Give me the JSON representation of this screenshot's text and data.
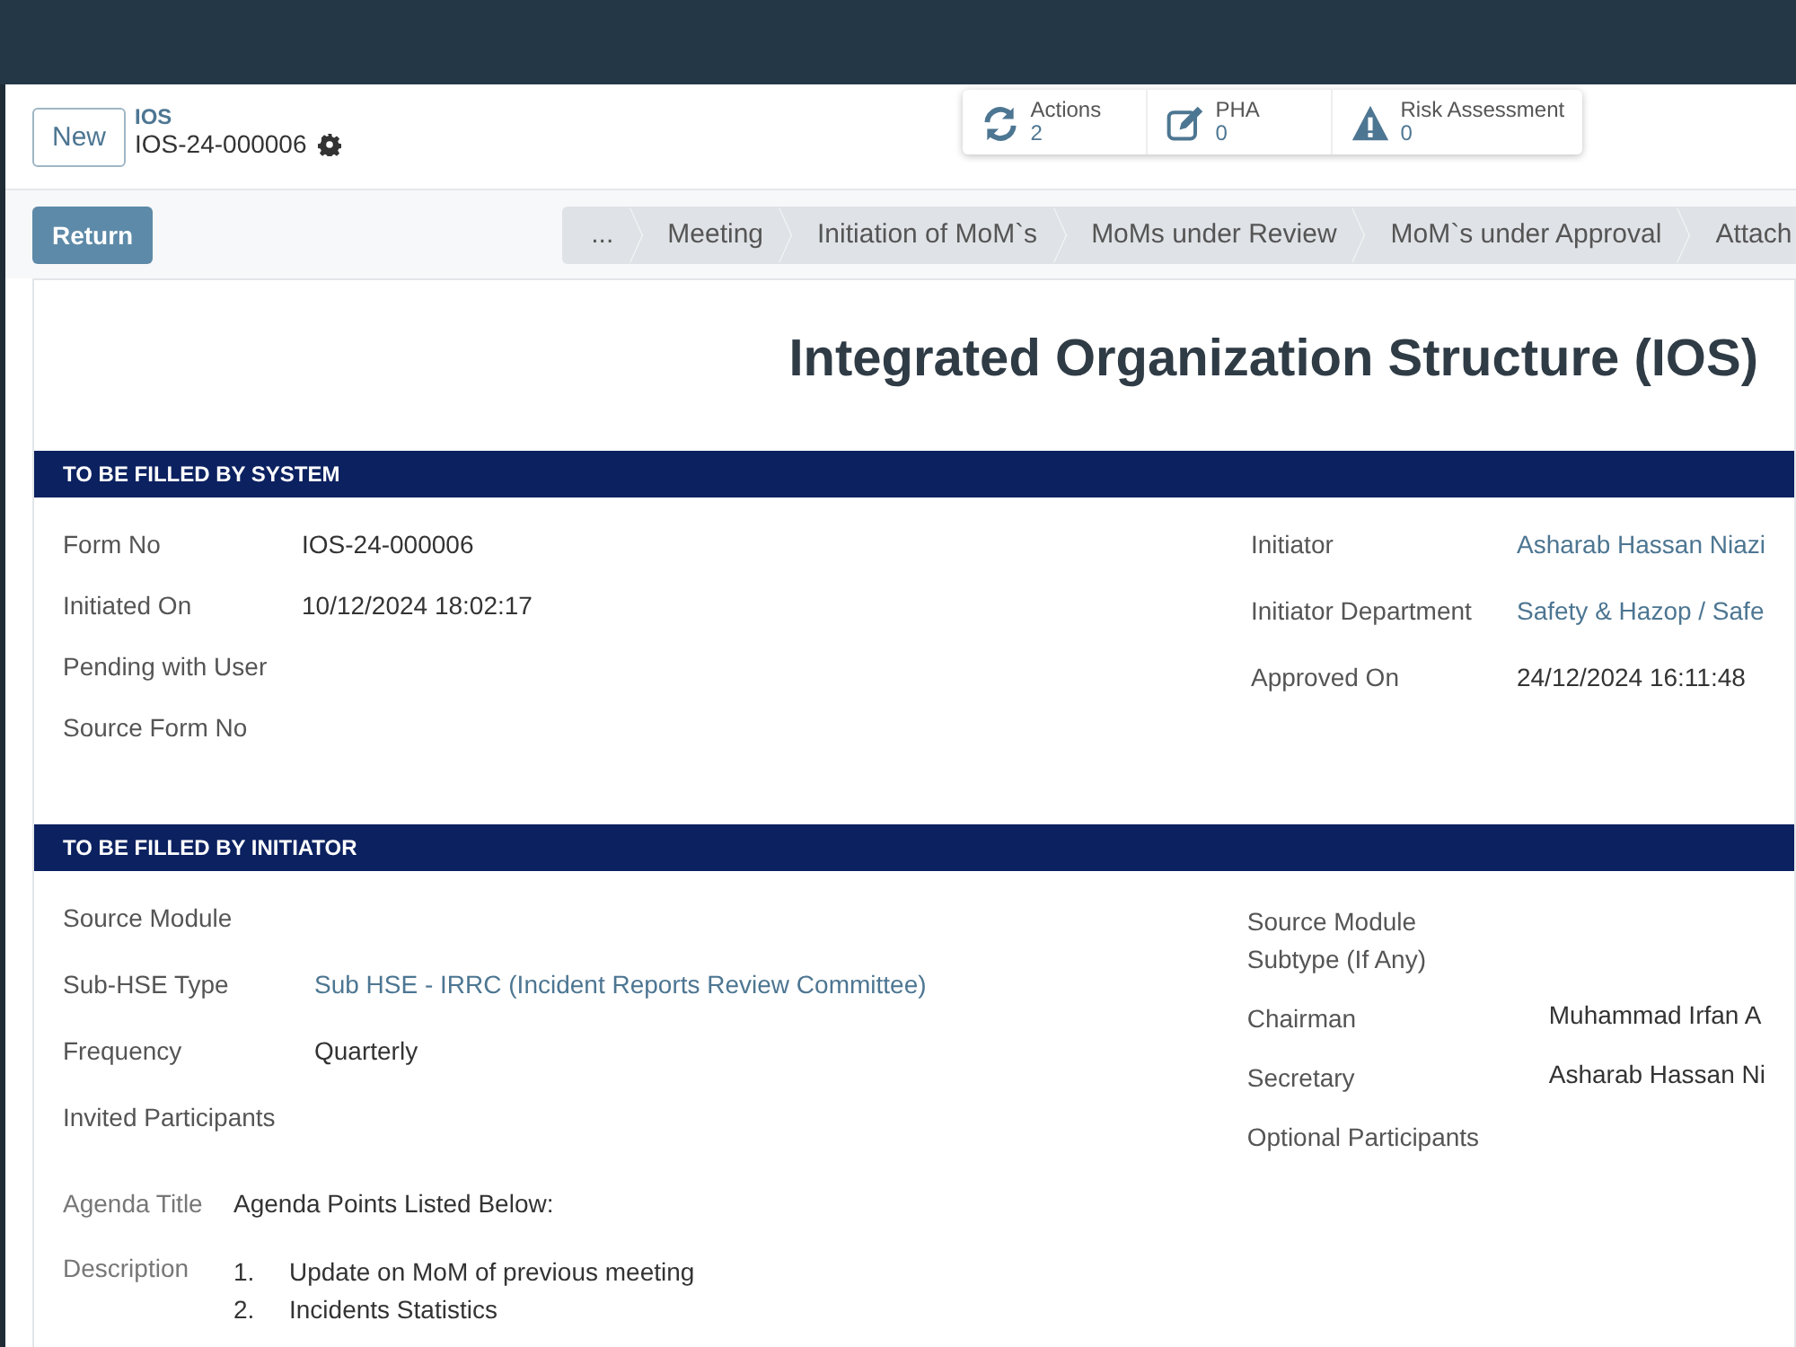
{
  "header": {
    "new_button": "New",
    "module": "IOS",
    "record_no": "IOS-24-000006"
  },
  "stats": [
    {
      "kind": "refresh",
      "label": "Actions",
      "count": "2"
    },
    {
      "kind": "edit",
      "label": "PHA",
      "count": "0"
    },
    {
      "kind": "warning",
      "label": "Risk Assessment",
      "count": "0"
    }
  ],
  "toolbar": {
    "return_button": "Return",
    "steps": [
      "...",
      "Meeting",
      "Initiation of MoM`s",
      "MoMs under Review",
      "MoM`s under Approval",
      "Attach"
    ]
  },
  "form": {
    "title": "Integrated Organization Structure (IOS)",
    "sections": [
      {
        "title": "TO BE FILLED BY SYSTEM",
        "left": [
          {
            "label": "Form No",
            "value": "IOS-24-000006",
            "link": false
          },
          {
            "label": "Initiated On",
            "value": "10/12/2024 18:02:17",
            "link": false
          },
          {
            "label": "Pending with User"
          },
          {
            "label": "Source Form No"
          }
        ],
        "right": [
          {
            "label": "Initiator",
            "value": "Asharab Hassan Niazi",
            "link": true
          },
          {
            "label": "Initiator Department",
            "value": "Safety & Hazop / Safe",
            "link": true
          },
          {
            "label": "Approved On",
            "value": "24/12/2024 16:11:48",
            "link": false
          }
        ]
      },
      {
        "title": "TO BE FILLED BY INITIATOR",
        "left": [
          {
            "label": "Source Module"
          },
          {
            "label": "Sub-HSE Type",
            "value": "Sub HSE - IRRC (Incident Reports Review Committee)",
            "link": true
          },
          {
            "label": "Frequency",
            "value": "Quarterly",
            "link": false
          },
          {
            "label": "Invited Participants"
          }
        ],
        "right": [
          {
            "label": "Source Module Subtype (If Any)"
          },
          {
            "label": "Chairman",
            "value": "Muhammad Irfan A",
            "link": false
          },
          {
            "label": "Secretary",
            "value": "Asharab Hassan Ni",
            "link": false
          },
          {
            "label": "Optional Participants"
          }
        ],
        "agenda": {
          "label": "Agenda Title",
          "value": "Agenda Points Listed Below:"
        },
        "description": {
          "label": "Description",
          "items": [
            {
              "number": "1.",
              "text": "Update on MoM of previous meeting"
            },
            {
              "number": "2.",
              "text": "Incidents Statistics"
            }
          ]
        }
      }
    ]
  }
}
